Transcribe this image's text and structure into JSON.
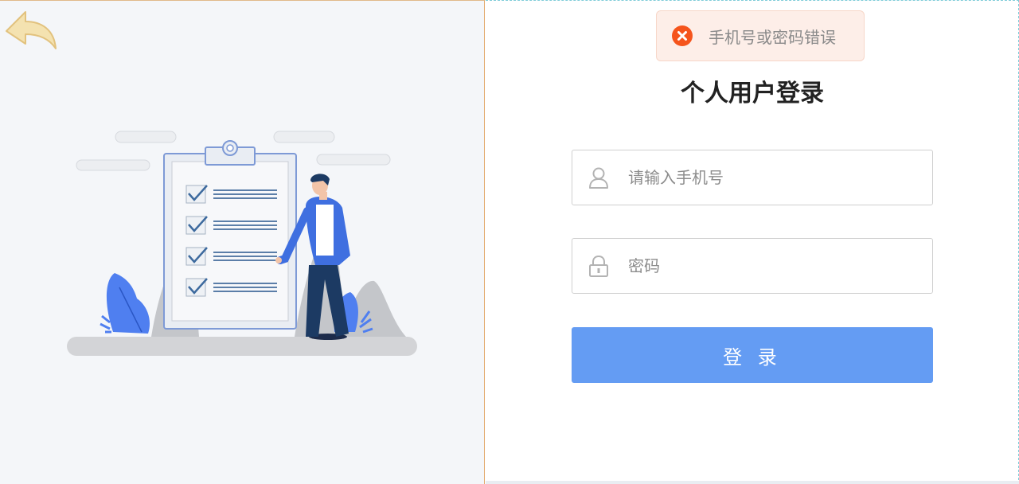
{
  "toast": {
    "message": "手机号或密码错误",
    "icon": "error-circle-icon",
    "color": "#f5541c"
  },
  "login": {
    "title": "个人用户登录",
    "phone_placeholder": "请输入手机号",
    "password_placeholder": "密码",
    "submit_label": "登 录",
    "button_color": "#649cf3"
  },
  "icons": {
    "back": "back-arrow-icon",
    "user": "user-icon",
    "lock": "lock-icon"
  }
}
